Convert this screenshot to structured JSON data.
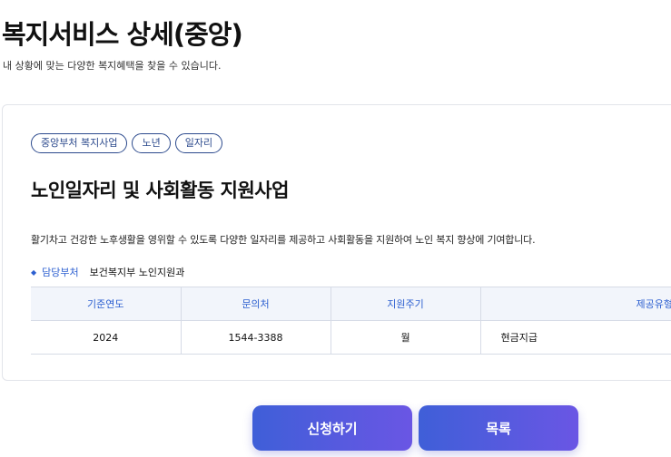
{
  "header": {
    "title": "복지서비스 상세(중앙)",
    "subtitle": "내 상황에 맞는 다양한 복지혜택을 찾을 수 있습니다."
  },
  "service": {
    "tags": [
      "중앙부처 복지사업",
      "노년",
      "일자리"
    ],
    "title": "노인일자리 및 사회활동 지원사업",
    "description": "활기차고 건강한 노후생활을 영위할 수 있도록 다양한 일자리를 제공하고 사회활동을 지원하여 노인 복지 향상에 기여합니다.",
    "department": {
      "label": "담당부처",
      "value": "보건복지부 노인지원과"
    }
  },
  "info_table": {
    "headers": [
      "기준연도",
      "문의처",
      "지원주기",
      "제공유형"
    ],
    "row": [
      "2024",
      "1544-3388",
      "월",
      "현금지급"
    ]
  },
  "buttons": {
    "apply": "신청하기",
    "list": "목록"
  }
}
